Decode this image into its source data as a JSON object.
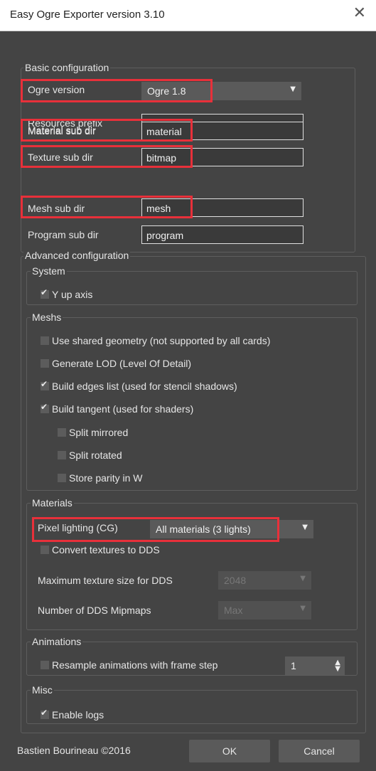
{
  "window": {
    "title": "Easy Ogre Exporter version 3.10",
    "close_glyph": "✕"
  },
  "basic": {
    "legend": "Basic configuration",
    "ogre_version_label": "Ogre version",
    "ogre_version_value": "Ogre 1.8",
    "resources_prefix_label": "Resources prefix",
    "resources_prefix_value": "",
    "material_label": "Material sub dir",
    "material_value": "material",
    "texture_label": "Texture sub dir",
    "texture_value": "bitmap",
    "mesh_label": "Mesh sub dir",
    "mesh_value": "mesh",
    "program_label": "Program sub dir",
    "program_value": "program"
  },
  "advanced": {
    "legend": "Advanced configuration",
    "system": {
      "legend": "System",
      "y_up": {
        "label": "Y up axis",
        "checked": true
      }
    },
    "meshs": {
      "legend": "Meshs",
      "shared_geometry": {
        "label": "Use shared geometry (not supported by all cards)",
        "checked": false
      },
      "generate_lod": {
        "label": "Generate LOD (Level Of Detail)",
        "checked": false
      },
      "edges_list": {
        "label": "Build edges list (used for stencil shadows)",
        "checked": true
      },
      "tangent": {
        "label": "Build tangent (used for shaders)",
        "checked": true
      },
      "split_mirrored": {
        "label": "Split mirrored",
        "checked": false
      },
      "split_rotated": {
        "label": "Split rotated",
        "checked": false
      },
      "store_parity": {
        "label": "Store parity in W",
        "checked": false
      }
    },
    "materials": {
      "legend": "Materials",
      "pixel_lighting_label": "Pixel lighting (CG)",
      "pixel_lighting_value": "All materials (3 lights)",
      "convert_dds": {
        "label": "Convert textures to DDS",
        "checked": false
      },
      "max_size_label": "Maximum texture size for DDS",
      "max_size_value": "2048",
      "mipmaps_label": "Number of DDS Mipmaps",
      "mipmaps_value": "Max"
    },
    "animations": {
      "legend": "Animations",
      "resample": {
        "label": "Resample animations with frame step",
        "checked": false
      },
      "frame_step_value": "1"
    },
    "misc": {
      "legend": "Misc",
      "enable_logs": {
        "label": "Enable logs",
        "checked": true
      }
    }
  },
  "footer": {
    "copyright": "Bastien Bourineau ©2016",
    "ok_label": "OK",
    "cancel_label": "Cancel"
  },
  "icons": {
    "dropdown": "chevron-down-icon",
    "check": "check-icon",
    "spinner": "spinner-arrows-icon"
  },
  "colors": {
    "background": "#444444",
    "highlight": "#e8303a",
    "control": "#5a5a5a"
  }
}
